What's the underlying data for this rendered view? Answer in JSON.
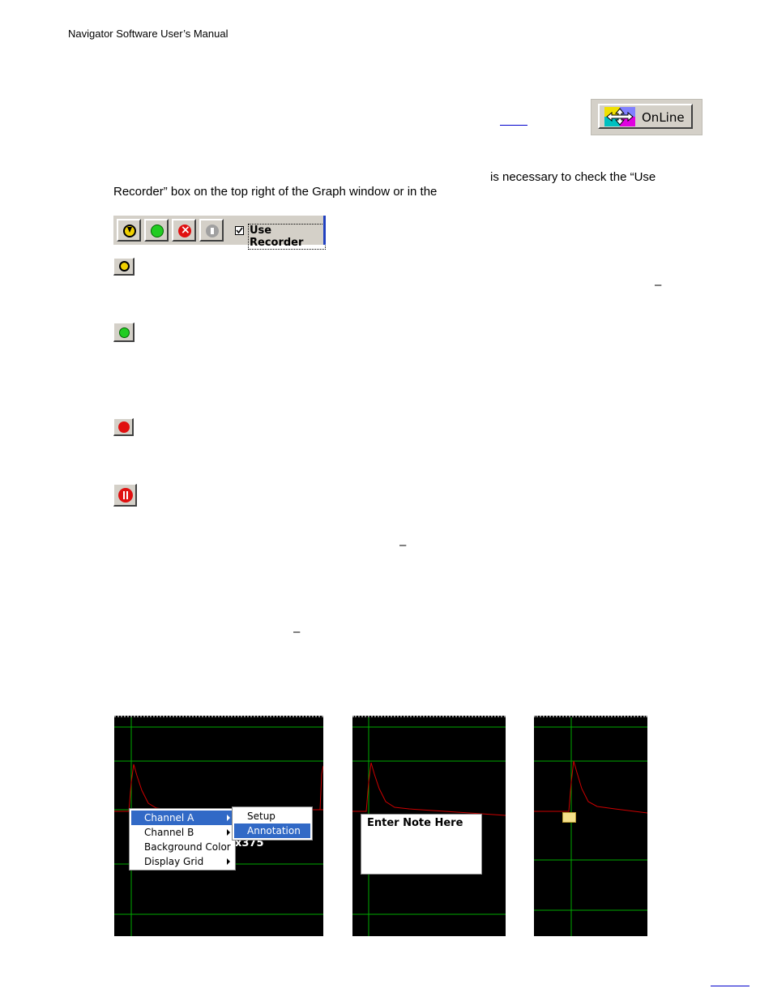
{
  "header": {
    "title": "Navigator Software User’s Manual"
  },
  "online_button": {
    "label": "OnLine",
    "icon": "arrows-icon"
  },
  "body_text": {
    "line1": "is necessary to check the “Use",
    "line2": "Recorder” box on the top right of the Graph window or in the"
  },
  "recorder_toolbar": {
    "checkbox_label": "Use Recorder",
    "checked": true,
    "buttons": [
      "download-icon",
      "record-icon",
      "stop-icon",
      "pause-icon"
    ]
  },
  "dashes": [
    "–",
    "–",
    "–"
  ],
  "context_menu": {
    "items": [
      "Channel A",
      "Channel B",
      "Background Color",
      "Display Grid"
    ],
    "submenu": [
      "Setup",
      "Annotation"
    ],
    "partial_text": "x375"
  },
  "annotation_box": {
    "text": "Enter Note Here"
  },
  "colors": {
    "graph_bg": "#000000",
    "grid": "#00aa00",
    "signal": "#cc0000",
    "menu_highlight": "#3169c6"
  }
}
